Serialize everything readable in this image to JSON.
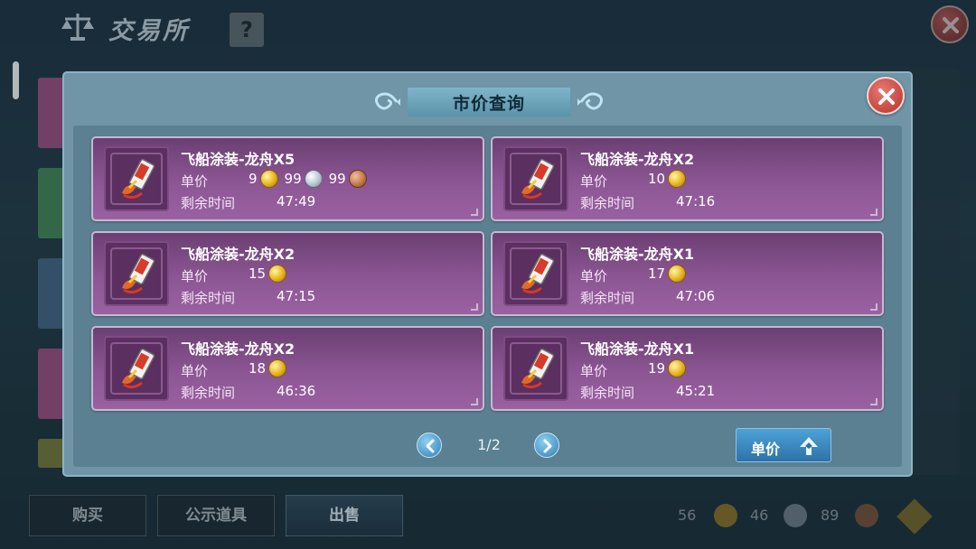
{
  "background": {
    "title": "交易所",
    "help_label": "?",
    "bottom_tabs": [
      {
        "label": "购买"
      },
      {
        "label": "公示道具"
      },
      {
        "label": "出售"
      }
    ],
    "currency": [
      {
        "amount": "56",
        "type": "gold"
      },
      {
        "amount": "46",
        "type": "silver"
      },
      {
        "amount": "89",
        "type": "bronze"
      }
    ]
  },
  "modal": {
    "title": "市价查询",
    "price_label": "单价",
    "time_label": "剩余时间",
    "listings": [
      {
        "name": "飞船涂装-龙舟X5",
        "price": [
          {
            "amount": "9",
            "coin": "gold"
          },
          {
            "amount": "99",
            "coin": "silver"
          },
          {
            "amount": "99",
            "coin": "bronze"
          }
        ],
        "time": "47:49"
      },
      {
        "name": "飞船涂装-龙舟X2",
        "price": [
          {
            "amount": "10",
            "coin": "gold"
          }
        ],
        "time": "47:16"
      },
      {
        "name": "飞船涂装-龙舟X2",
        "price": [
          {
            "amount": "15",
            "coin": "gold"
          }
        ],
        "time": "47:15"
      },
      {
        "name": "飞船涂装-龙舟X1",
        "price": [
          {
            "amount": "17",
            "coin": "gold"
          }
        ],
        "time": "47:06"
      },
      {
        "name": "飞船涂装-龙舟X2",
        "price": [
          {
            "amount": "18",
            "coin": "gold"
          }
        ],
        "time": "46:36"
      },
      {
        "name": "飞船涂装-龙舟X1",
        "price": [
          {
            "amount": "19",
            "coin": "gold"
          }
        ],
        "time": "45:21"
      }
    ],
    "pagination": {
      "indicator": "1/2",
      "current_page": 1,
      "total_pages": 2
    },
    "sort_button_label": "单价"
  },
  "colors": {
    "card_purple": "#8c5694",
    "modal_blue": "#6f95a7",
    "close_red": "#c9403a",
    "gold": "#e6b31f"
  },
  "icons": {
    "close": "close-x-icon",
    "prev": "chevron-left-icon",
    "next": "chevron-right-icon",
    "sort": "sort-up-arrow-icon",
    "item": "ship-skin-item-icon",
    "title": "scale-icon"
  }
}
